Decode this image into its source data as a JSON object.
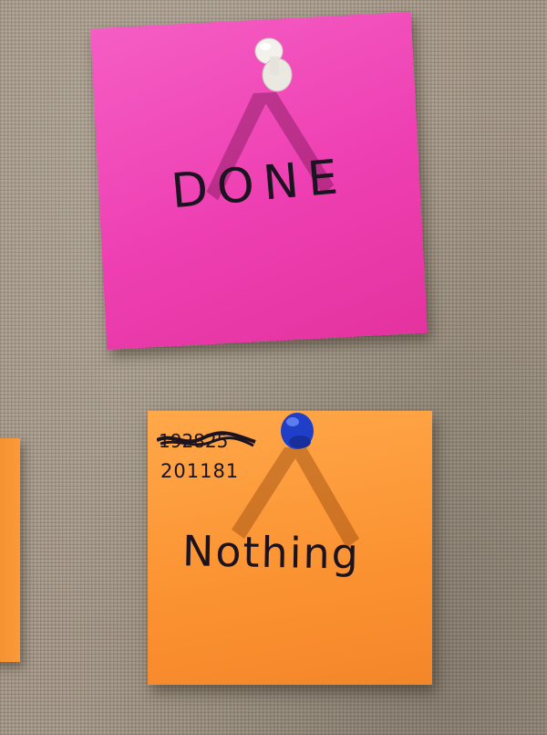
{
  "scene": {
    "board": "burlap-bulletin-board"
  },
  "notes": [
    {
      "color": "#ee3fb2",
      "text": "DONE",
      "pin_color": "#f4f1ec"
    },
    {
      "color": "#fb9231",
      "struck_number": "192825",
      "number": "201181",
      "text": "Nothing",
      "pin_color": "#1f3fc9"
    }
  ]
}
